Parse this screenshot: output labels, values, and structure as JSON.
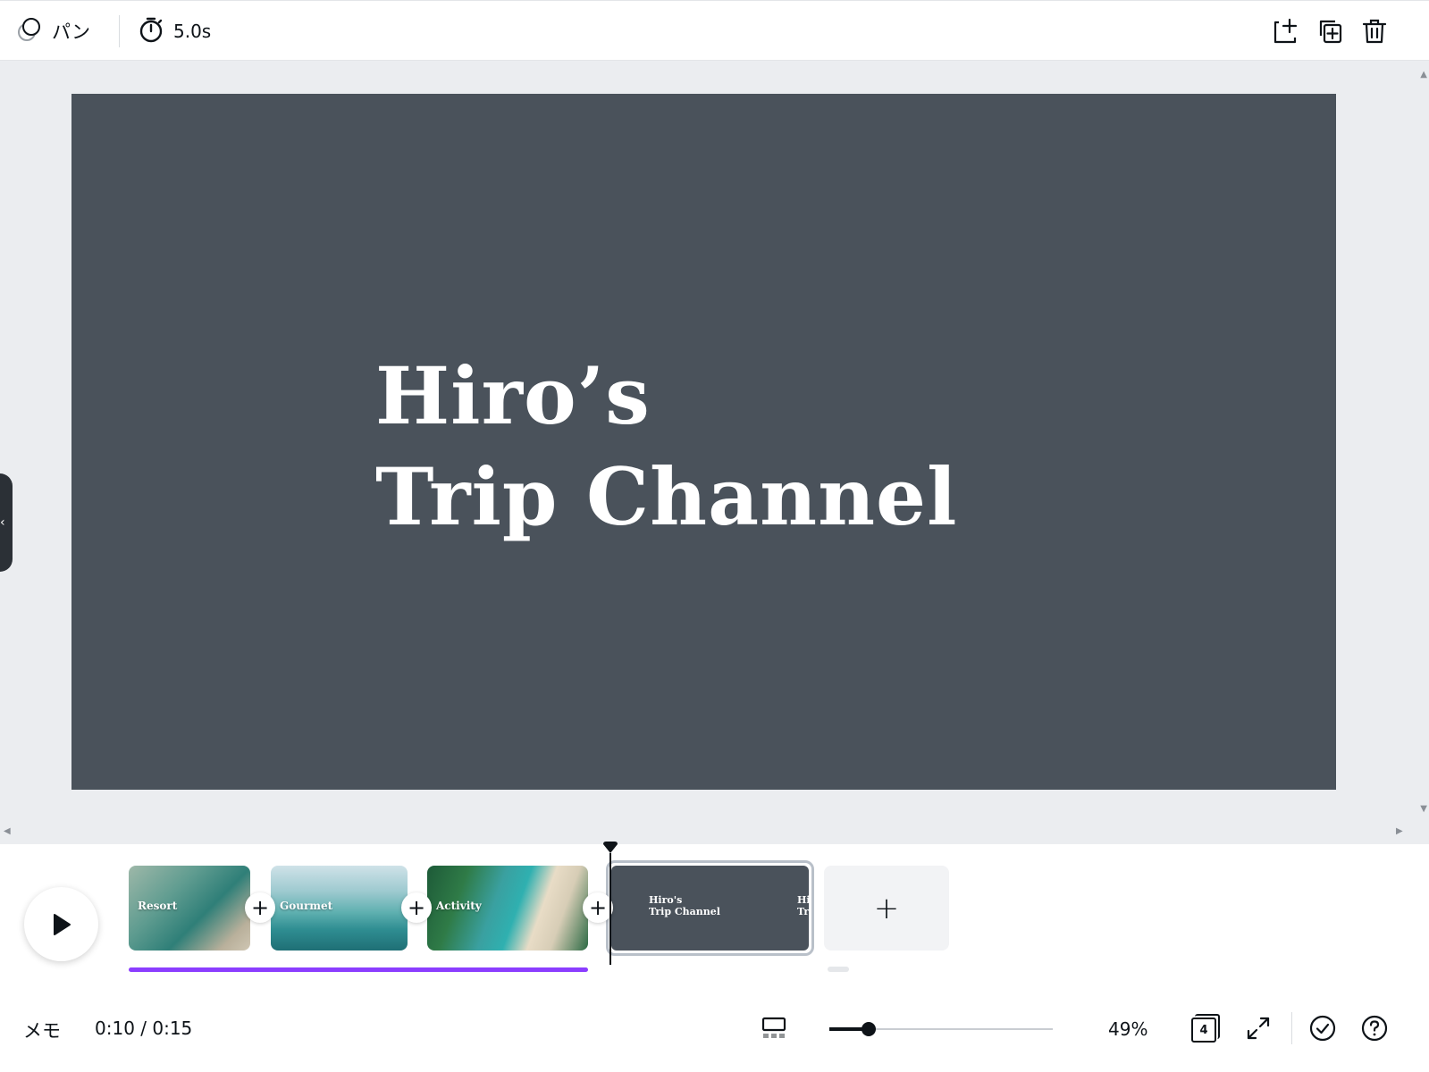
{
  "toolbar": {
    "animation_label": "パン",
    "duration": "5.0s"
  },
  "slide": {
    "title_line1": "Hiro’s",
    "title_line2": "Trip Channel",
    "background": "#4a525b"
  },
  "timeline": {
    "clips": [
      {
        "label": "Resort"
      },
      {
        "label": "Gourmet"
      },
      {
        "label": "Activity"
      },
      {
        "label_line1": "Hiro's",
        "label_line2": "Trip Channel",
        "peek_line1": "Hi",
        "peek_line2": "Tr"
      }
    ],
    "add_clip_icon": "+",
    "insert_icon": "+",
    "progress_fraction": 0.667,
    "accent": "#8b3dff"
  },
  "bottom": {
    "memo_label": "メモ",
    "time": "0:10 / 0:15",
    "zoom": "49%",
    "zoom_value": 49,
    "page_count": "4"
  }
}
